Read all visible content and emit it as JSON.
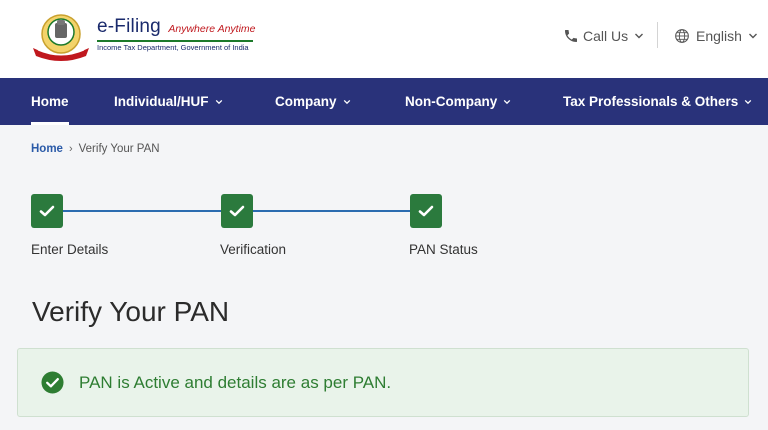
{
  "header": {
    "brand_main": "e-Filing",
    "brand_tagline": "Anywhere Anytime",
    "brand_subtitle": "Income Tax Department, Government of India",
    "call_us": "Call Us",
    "language": "English"
  },
  "nav": {
    "items": [
      {
        "label": "Home",
        "active": true
      },
      {
        "label": "Individual/HUF",
        "has_dropdown": true
      },
      {
        "label": "Company",
        "has_dropdown": true
      },
      {
        "label": "Non-Company",
        "has_dropdown": true
      },
      {
        "label": "Tax Professionals & Others",
        "has_dropdown": true
      }
    ]
  },
  "breadcrumb": {
    "home": "Home",
    "separator": "›",
    "current": "Verify Your PAN"
  },
  "steps": [
    {
      "label": "Enter Details",
      "status": "complete"
    },
    {
      "label": "Verification",
      "status": "complete"
    },
    {
      "label": "PAN Status",
      "status": "complete"
    }
  ],
  "page_title": "Verify Your PAN",
  "alert": {
    "message": "PAN is Active and details are as per PAN.",
    "type": "success"
  },
  "colors": {
    "nav_bg": "#29327a",
    "step_complete": "#2b7a3d",
    "step_line": "#2b6cb0",
    "success_text": "#2e7d32",
    "success_bg": "#e9f3ea",
    "link": "#2a5aa8"
  },
  "icons": {
    "call": "phone-icon",
    "language": "globe-icon",
    "step": "check-icon",
    "alert": "check-circle-icon"
  }
}
